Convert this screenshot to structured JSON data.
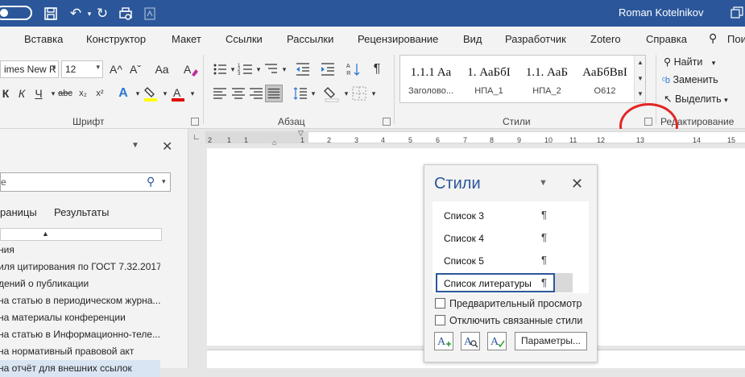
{
  "titlebar": {
    "user_name": "Roman Kotelnikov",
    "accent_color": "#2b579a"
  },
  "quick_access": {
    "icons": [
      "autosave-toggle-icon",
      "save-icon",
      "undo-icon",
      "redo-icon",
      "print-preview-icon",
      "format-painter-icon"
    ]
  },
  "menu": {
    "tabs": [
      "Вставка",
      "Конструктор",
      "Макет",
      "Ссылки",
      "Рассылки",
      "Рецензирование",
      "Вид",
      "Разработчик",
      "Zotero",
      "Справка"
    ],
    "search_label": "Пои"
  },
  "font_group": {
    "font_name": "imes New R",
    "font_size": "12",
    "grow_label": "A^",
    "shrink_label": "Aˇ",
    "case_label": "Aa",
    "bold": "К",
    "underline": "Ч",
    "strike": "abc",
    "subscript": "x₂",
    "superscript": "x²",
    "label": "Шрифт"
  },
  "paragraph_group": {
    "pilcrow": "¶",
    "label": "Абзац"
  },
  "styles_group": {
    "items": [
      {
        "sample": "1.1.1 Aa",
        "name": "Заголово..."
      },
      {
        "sample": "1. АаБбІ",
        "name": "НПА_1"
      },
      {
        "sample": "1.1. АаБ",
        "name": "НПА_2"
      },
      {
        "sample": "АаБбВвI",
        "name": "О612"
      }
    ],
    "label": "Стили"
  },
  "editing_group": {
    "find": "Найти",
    "replace": "Заменить",
    "select": "Выделить",
    "label": "Редактирование"
  },
  "nav_pane": {
    "search_value": "е",
    "tabs": [
      "раницы",
      "Результаты"
    ],
    "items": [
      "ния",
      "иля цитирования по ГОСТ 7.32.2017",
      "дений о публикации",
      "на статью в периодическом журна...",
      "на материалы конференции",
      "на статью в Информационно-теле...",
      "на нормативный правовой акт",
      "на отчёт для внешних ссылок"
    ]
  },
  "ruler": {
    "ticks": [
      "2",
      "1",
      "1",
      "1",
      "2",
      "3",
      "4",
      "5",
      "6",
      "7",
      "8",
      "9",
      "10",
      "11",
      "12",
      "13",
      "14",
      "15"
    ]
  },
  "styles_pane": {
    "title": "Стили",
    "items": [
      "Список 3",
      "Список 4",
      "Список 5",
      "Список литературы"
    ],
    "selected_index": 3,
    "pilcrow": "¶",
    "preview_label": "Предварительный просмотр",
    "preview_checked": false,
    "disable_linked_label": "Отключить связанные стили",
    "disable_linked_checked": false,
    "options_label": "Параметры..."
  },
  "annotation": {
    "circle_color": "#e32626"
  }
}
